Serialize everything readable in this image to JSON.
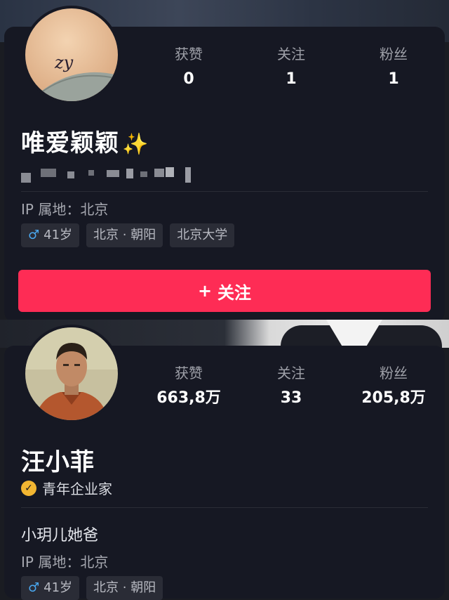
{
  "profile1": {
    "name": "唯爱颖颖",
    "name_emoji": "✨",
    "stats": [
      {
        "label": "获赞",
        "value": "0"
      },
      {
        "label": "关注",
        "value": "1"
      },
      {
        "label": "粉丝",
        "value": "1"
      }
    ],
    "ip": "IP 属地：北京",
    "tags": {
      "gender_icon": "♂",
      "age": "41岁",
      "location": "北京 · 朝阳",
      "school": "北京大学"
    },
    "follow_button": {
      "icon": "+",
      "label": "关注"
    }
  },
  "profile2": {
    "name": "汪小菲",
    "stats": [
      {
        "label": "获赞",
        "value": "663,8万"
      },
      {
        "label": "关注",
        "value": "33"
      },
      {
        "label": "粉丝",
        "value": "205,8万"
      }
    ],
    "verified_badge_icon": "✓",
    "verified_title": "青年企业家",
    "bio": "小玥儿她爸",
    "ip": "IP 属地：北京",
    "tags": {
      "gender_icon": "♂",
      "age": "41岁",
      "location": "北京 · 朝阳"
    }
  },
  "colors": {
    "background": "#161823",
    "accent": "#fe2c55",
    "badge": "#f2b632",
    "gender": "#4aa8f0"
  }
}
